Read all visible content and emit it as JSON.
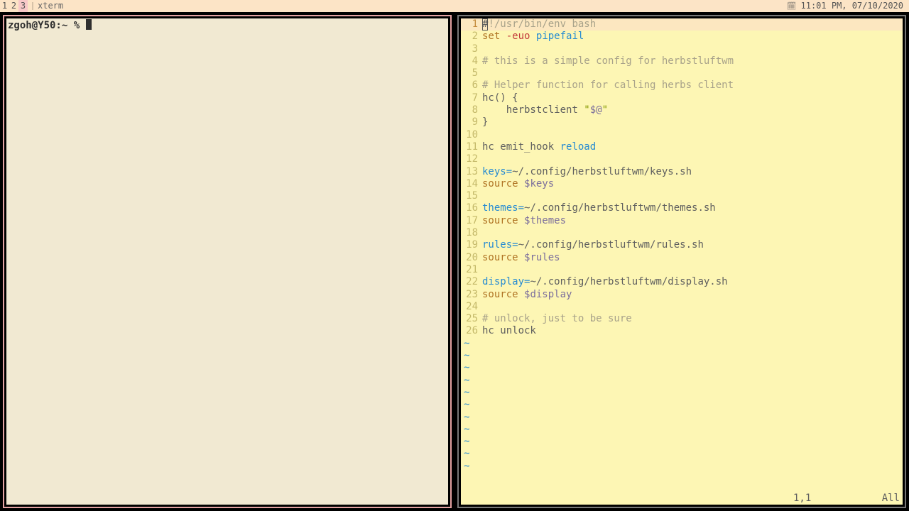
{
  "bar": {
    "tags": [
      "1",
      "2",
      "3"
    ],
    "active_tag_index": 2,
    "window_title": "xterm",
    "clock": "11:01 PM, 07/10/2020",
    "calendar_icon": "🗓"
  },
  "terminal": {
    "prompt": "zgoh@Y50:~ % "
  },
  "vim": {
    "cursor_line": 1,
    "lines": [
      {
        "n": 1,
        "seg": [
          [
            "cursor",
            "#"
          ],
          [
            "c-comment",
            "!/usr/bin/env bash"
          ]
        ]
      },
      {
        "n": 2,
        "seg": [
          [
            "c-kw",
            "set"
          ],
          [
            "",
            " "
          ],
          [
            "c-opt",
            "-euo"
          ],
          [
            "",
            " "
          ],
          [
            "c-id",
            "pipefail"
          ]
        ]
      },
      {
        "n": 3,
        "seg": [
          [
            "",
            ""
          ]
        ]
      },
      {
        "n": 4,
        "seg": [
          [
            "c-comment",
            "# this is a simple config for herbstluftwm"
          ]
        ]
      },
      {
        "n": 5,
        "seg": [
          [
            "",
            ""
          ]
        ]
      },
      {
        "n": 6,
        "seg": [
          [
            "c-comment",
            "# Helper function for calling herbs client"
          ]
        ]
      },
      {
        "n": 7,
        "seg": [
          [
            "c-func",
            "hc() {"
          ]
        ]
      },
      {
        "n": 8,
        "seg": [
          [
            "",
            "    herbstclient "
          ],
          [
            "c-str",
            "\""
          ],
          [
            "c-var",
            "$@"
          ],
          [
            "c-str",
            "\""
          ]
        ]
      },
      {
        "n": 9,
        "seg": [
          [
            "c-func",
            "}"
          ]
        ]
      },
      {
        "n": 10,
        "seg": [
          [
            "",
            ""
          ]
        ]
      },
      {
        "n": 11,
        "seg": [
          [
            "",
            "hc emit_hook "
          ],
          [
            "c-id",
            "reload"
          ]
        ]
      },
      {
        "n": 12,
        "seg": [
          [
            "",
            ""
          ]
        ]
      },
      {
        "n": 13,
        "seg": [
          [
            "c-id",
            "keys="
          ],
          [
            "",
            "~/.config/herbstluftwm/keys.sh"
          ]
        ]
      },
      {
        "n": 14,
        "seg": [
          [
            "c-kw",
            "source"
          ],
          [
            "",
            " "
          ],
          [
            "c-var",
            "$keys"
          ]
        ]
      },
      {
        "n": 15,
        "seg": [
          [
            "",
            ""
          ]
        ]
      },
      {
        "n": 16,
        "seg": [
          [
            "c-id",
            "themes="
          ],
          [
            "",
            "~/.config/herbstluftwm/themes.sh"
          ]
        ]
      },
      {
        "n": 17,
        "seg": [
          [
            "c-kw",
            "source"
          ],
          [
            "",
            " "
          ],
          [
            "c-var",
            "$themes"
          ]
        ]
      },
      {
        "n": 18,
        "seg": [
          [
            "",
            ""
          ]
        ]
      },
      {
        "n": 19,
        "seg": [
          [
            "c-id",
            "rules="
          ],
          [
            "",
            "~/.config/herbstluftwm/rules.sh"
          ]
        ]
      },
      {
        "n": 20,
        "seg": [
          [
            "c-kw",
            "source"
          ],
          [
            "",
            " "
          ],
          [
            "c-var",
            "$rules"
          ]
        ]
      },
      {
        "n": 21,
        "seg": [
          [
            "",
            ""
          ]
        ]
      },
      {
        "n": 22,
        "seg": [
          [
            "c-id",
            "display="
          ],
          [
            "",
            "~/.config/herbstluftwm/display.sh"
          ]
        ]
      },
      {
        "n": 23,
        "seg": [
          [
            "c-kw",
            "source"
          ],
          [
            "",
            " "
          ],
          [
            "c-var",
            "$display"
          ]
        ]
      },
      {
        "n": 24,
        "seg": [
          [
            "",
            ""
          ]
        ]
      },
      {
        "n": 25,
        "seg": [
          [
            "c-comment",
            "# unlock, just to be sure"
          ]
        ]
      },
      {
        "n": 26,
        "seg": [
          [
            "",
            "hc unlock"
          ]
        ]
      }
    ],
    "tilde_rows": 11,
    "status": {
      "pos": "1,1",
      "pct": "All"
    }
  }
}
